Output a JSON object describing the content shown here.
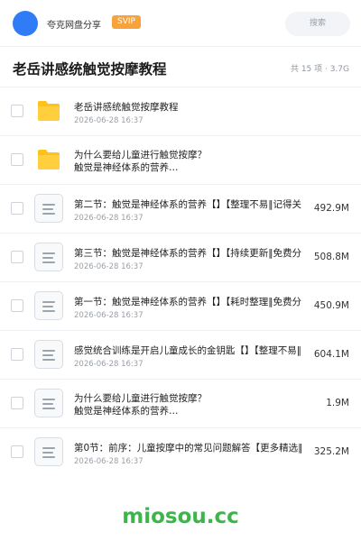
{
  "header": {
    "username": "夸克网盘分享",
    "badge": "SVIP",
    "search_placeholder": "搜索"
  },
  "folder": {
    "title": "老岳讲感统触觉按摩教程",
    "summary": "共 15 项 · 3.7G"
  },
  "files": [
    {
      "type": "folder",
      "name": "老岳讲感统触觉按摩教程",
      "date": "2026-06-28 16:37",
      "size": ""
    },
    {
      "type": "folder",
      "name": "为什么要给儿童进行触觉按摩？\n触觉是神经体系的营养…",
      "date": "",
      "size": ""
    },
    {
      "type": "file",
      "name": "第二节：触觉是神经体系的营养【】【整理不易‖记得关",
      "date": "2026-06-28 16:37",
      "size": "492.9M"
    },
    {
      "type": "file",
      "name": "第三节：触觉是神经体系的营养【】【持续更新‖免费分",
      "date": "2026-06-28 16:37",
      "size": "508.8M"
    },
    {
      "type": "file",
      "name": "第一节：触觉是神经体系的营养【】【耗时整理‖免费分",
      "date": "2026-06-28 16:37",
      "size": "450.9M"
    },
    {
      "type": "file",
      "name": "感觉统合训练是开启儿童成长的金钥匙【】【整理不易‖",
      "date": "2026-06-28 16:37",
      "size": "604.1M"
    },
    {
      "type": "file",
      "name": "为什么要给儿童进行触觉按摩？\n触觉是神经体系的营养…",
      "date": "",
      "size": "1.9M"
    },
    {
      "type": "file",
      "name": "第0节：前序：儿童按摩中的常见问题解答【更多精选‖",
      "date": "2026-06-28 16:37",
      "size": "325.2M"
    }
  ],
  "watermark": "miosou.cc",
  "colors": {
    "accent": "#2f7cf6",
    "svip": "#f7a23b",
    "folder": "#ffc21a",
    "watermark": "#3cb54a"
  }
}
